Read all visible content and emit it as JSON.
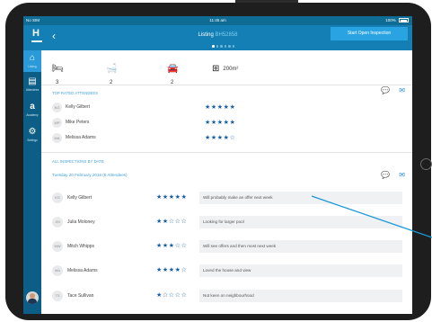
{
  "status": {
    "left": "No SIM",
    "time": "11:45 am",
    "battery": "100%"
  },
  "header": {
    "logo": "H",
    "title_prefix": "Listing ",
    "title_ref": "BH52858",
    "start_button": "Start Open Inspection"
  },
  "sidebar": [
    {
      "label": "Listing",
      "icon": "home-icon",
      "glyph": "⌂"
    },
    {
      "label": "Attendees",
      "icon": "attendees-icon",
      "glyph": "▤"
    },
    {
      "label": "Academy",
      "icon": "academy-icon",
      "glyph": "a"
    },
    {
      "label": "Settings",
      "icon": "settings-icon",
      "glyph": "⚙"
    }
  ],
  "features": {
    "beds": "3",
    "baths": "2",
    "cars": "2",
    "area": "200m²"
  },
  "top_rated": {
    "title": "TOP RATED ATTENDEES",
    "attendees": [
      {
        "initials": "KG",
        "name": "Kelly Gilbert",
        "rating": 5
      },
      {
        "initials": "MP",
        "name": "Mike Peters",
        "rating": 5
      },
      {
        "initials": "MA",
        "name": "Melissa Adams",
        "rating": 4
      }
    ]
  },
  "inspections": {
    "title": "ALL INSPECTIONS BY DATE",
    "date_heading": "Tuesday 20 February 2018 (8 Attendees)",
    "rows": [
      {
        "initials": "KG",
        "name": "Kelly Gilbert",
        "rating": 5,
        "comment": "Will probably make an offer next week"
      },
      {
        "initials": "JM",
        "name": "Julia Moloney",
        "rating": 2,
        "comment": "Looking for larger pool"
      },
      {
        "initials": "MW",
        "name": "Mitch Whipps",
        "rating": 3,
        "comment": "Will see offers and then most next week"
      },
      {
        "initials": "MA",
        "name": "Melissa Adams",
        "rating": 4,
        "comment": "Loved the house and view"
      },
      {
        "initials": "TS",
        "name": "Tace Sullivan",
        "rating": 1,
        "comment": "Not keen on neighbourhood"
      }
    ]
  },
  "colors": {
    "header": "#137fb4",
    "sidebar": "#0c5e86",
    "accent": "#3aa0d8",
    "star": "#1a5fa0",
    "pointer": "#1a9ad6"
  }
}
